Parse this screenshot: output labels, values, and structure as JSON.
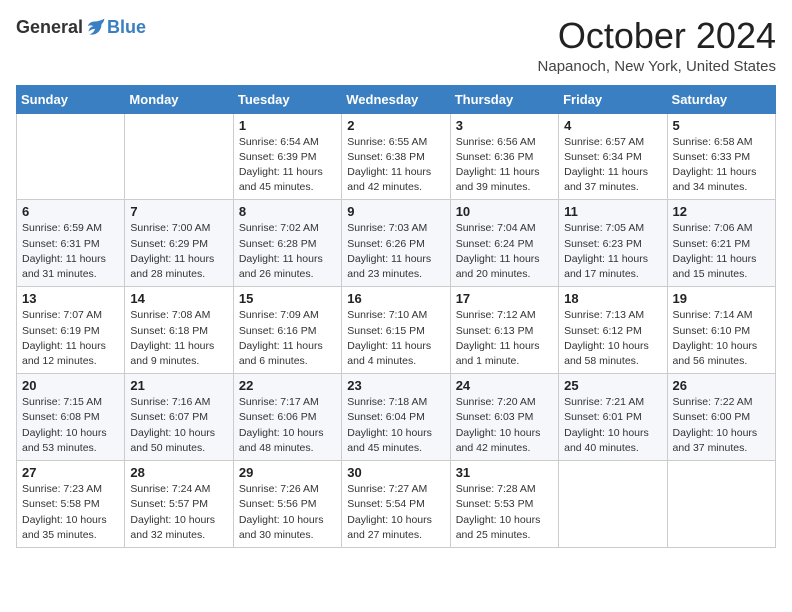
{
  "header": {
    "logo": {
      "general": "General",
      "blue": "Blue"
    },
    "title": "October 2024",
    "location": "Napanoch, New York, United States"
  },
  "calendar": {
    "days_of_week": [
      "Sunday",
      "Monday",
      "Tuesday",
      "Wednesday",
      "Thursday",
      "Friday",
      "Saturday"
    ],
    "weeks": [
      {
        "row_class": "row-odd",
        "days": [
          {
            "num": "",
            "info": ""
          },
          {
            "num": "",
            "info": ""
          },
          {
            "num": "1",
            "info": "Sunrise: 6:54 AM\nSunset: 6:39 PM\nDaylight: 11 hours and 45 minutes."
          },
          {
            "num": "2",
            "info": "Sunrise: 6:55 AM\nSunset: 6:38 PM\nDaylight: 11 hours and 42 minutes."
          },
          {
            "num": "3",
            "info": "Sunrise: 6:56 AM\nSunset: 6:36 PM\nDaylight: 11 hours and 39 minutes."
          },
          {
            "num": "4",
            "info": "Sunrise: 6:57 AM\nSunset: 6:34 PM\nDaylight: 11 hours and 37 minutes."
          },
          {
            "num": "5",
            "info": "Sunrise: 6:58 AM\nSunset: 6:33 PM\nDaylight: 11 hours and 34 minutes."
          }
        ]
      },
      {
        "row_class": "row-even",
        "days": [
          {
            "num": "6",
            "info": "Sunrise: 6:59 AM\nSunset: 6:31 PM\nDaylight: 11 hours and 31 minutes."
          },
          {
            "num": "7",
            "info": "Sunrise: 7:00 AM\nSunset: 6:29 PM\nDaylight: 11 hours and 28 minutes."
          },
          {
            "num": "8",
            "info": "Sunrise: 7:02 AM\nSunset: 6:28 PM\nDaylight: 11 hours and 26 minutes."
          },
          {
            "num": "9",
            "info": "Sunrise: 7:03 AM\nSunset: 6:26 PM\nDaylight: 11 hours and 23 minutes."
          },
          {
            "num": "10",
            "info": "Sunrise: 7:04 AM\nSunset: 6:24 PM\nDaylight: 11 hours and 20 minutes."
          },
          {
            "num": "11",
            "info": "Sunrise: 7:05 AM\nSunset: 6:23 PM\nDaylight: 11 hours and 17 minutes."
          },
          {
            "num": "12",
            "info": "Sunrise: 7:06 AM\nSunset: 6:21 PM\nDaylight: 11 hours and 15 minutes."
          }
        ]
      },
      {
        "row_class": "row-odd",
        "days": [
          {
            "num": "13",
            "info": "Sunrise: 7:07 AM\nSunset: 6:19 PM\nDaylight: 11 hours and 12 minutes."
          },
          {
            "num": "14",
            "info": "Sunrise: 7:08 AM\nSunset: 6:18 PM\nDaylight: 11 hours and 9 minutes."
          },
          {
            "num": "15",
            "info": "Sunrise: 7:09 AM\nSunset: 6:16 PM\nDaylight: 11 hours and 6 minutes."
          },
          {
            "num": "16",
            "info": "Sunrise: 7:10 AM\nSunset: 6:15 PM\nDaylight: 11 hours and 4 minutes."
          },
          {
            "num": "17",
            "info": "Sunrise: 7:12 AM\nSunset: 6:13 PM\nDaylight: 11 hours and 1 minute."
          },
          {
            "num": "18",
            "info": "Sunrise: 7:13 AM\nSunset: 6:12 PM\nDaylight: 10 hours and 58 minutes."
          },
          {
            "num": "19",
            "info": "Sunrise: 7:14 AM\nSunset: 6:10 PM\nDaylight: 10 hours and 56 minutes."
          }
        ]
      },
      {
        "row_class": "row-even",
        "days": [
          {
            "num": "20",
            "info": "Sunrise: 7:15 AM\nSunset: 6:08 PM\nDaylight: 10 hours and 53 minutes."
          },
          {
            "num": "21",
            "info": "Sunrise: 7:16 AM\nSunset: 6:07 PM\nDaylight: 10 hours and 50 minutes."
          },
          {
            "num": "22",
            "info": "Sunrise: 7:17 AM\nSunset: 6:06 PM\nDaylight: 10 hours and 48 minutes."
          },
          {
            "num": "23",
            "info": "Sunrise: 7:18 AM\nSunset: 6:04 PM\nDaylight: 10 hours and 45 minutes."
          },
          {
            "num": "24",
            "info": "Sunrise: 7:20 AM\nSunset: 6:03 PM\nDaylight: 10 hours and 42 minutes."
          },
          {
            "num": "25",
            "info": "Sunrise: 7:21 AM\nSunset: 6:01 PM\nDaylight: 10 hours and 40 minutes."
          },
          {
            "num": "26",
            "info": "Sunrise: 7:22 AM\nSunset: 6:00 PM\nDaylight: 10 hours and 37 minutes."
          }
        ]
      },
      {
        "row_class": "row-odd",
        "days": [
          {
            "num": "27",
            "info": "Sunrise: 7:23 AM\nSunset: 5:58 PM\nDaylight: 10 hours and 35 minutes."
          },
          {
            "num": "28",
            "info": "Sunrise: 7:24 AM\nSunset: 5:57 PM\nDaylight: 10 hours and 32 minutes."
          },
          {
            "num": "29",
            "info": "Sunrise: 7:26 AM\nSunset: 5:56 PM\nDaylight: 10 hours and 30 minutes."
          },
          {
            "num": "30",
            "info": "Sunrise: 7:27 AM\nSunset: 5:54 PM\nDaylight: 10 hours and 27 minutes."
          },
          {
            "num": "31",
            "info": "Sunrise: 7:28 AM\nSunset: 5:53 PM\nDaylight: 10 hours and 25 minutes."
          },
          {
            "num": "",
            "info": ""
          },
          {
            "num": "",
            "info": ""
          }
        ]
      }
    ]
  }
}
